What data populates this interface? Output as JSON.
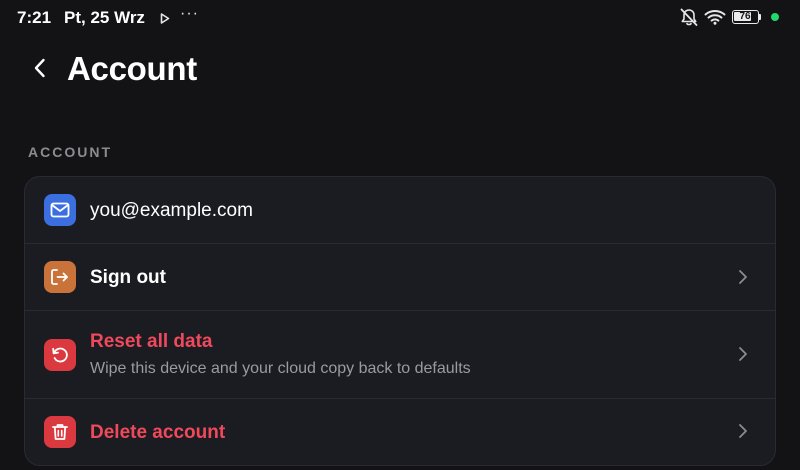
{
  "status_bar": {
    "time": "7:21",
    "date": "Pt, 25 Wrz",
    "more": "···",
    "battery_level": "76",
    "battery_percent": 76,
    "icons": [
      "play-icon",
      "bell-muted-icon",
      "wifi-icon",
      "battery-icon",
      "status-dot-icon"
    ],
    "dot_color": "#21d96b"
  },
  "header": {
    "back_icon": "chevron-left-icon",
    "title": "Account"
  },
  "section": {
    "label": "ACCOUNT"
  },
  "rows": [
    {
      "title": "you@example.com",
      "icon": "mail-icon",
      "icon_color": "#3b6fe0"
    },
    {
      "title": "Sign out",
      "icon": "sign-out-icon",
      "icon_color": "#c9733a"
    },
    {
      "title": "Reset all data",
      "subtitle": "Wipe this device and your cloud copy back to defaults",
      "icon": "reset-icon",
      "icon_color": "#d9393f"
    },
    {
      "title": "Delete account",
      "icon": "trash-icon",
      "icon_color": "#d9393f"
    }
  ],
  "colors": {
    "background": "#131316",
    "card": "#1b1c22",
    "danger_text": "#f0495b",
    "muted_text": "#9a9aa2"
  }
}
